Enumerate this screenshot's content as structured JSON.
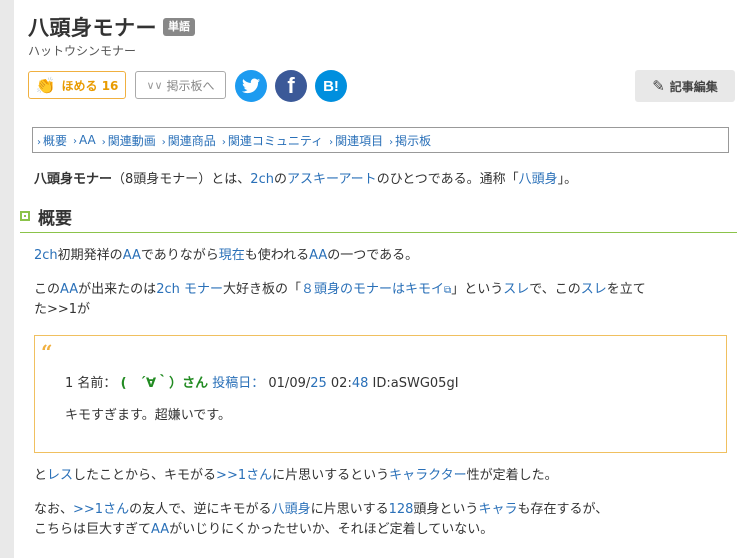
{
  "article": {
    "title": "八頭身モナー",
    "tag": "単語",
    "reading": "ハットウシンモナー"
  },
  "buttons": {
    "homeru": "ほめる 16",
    "keiji": "掲示板へ",
    "edit": "記事編集"
  },
  "toc": [
    "概要",
    "AA",
    "関連動画",
    "関連商品",
    "関連コミュニティ",
    "関連項目",
    "掲示板"
  ],
  "intro": {
    "bold": "八頭身モナー",
    "t1": "（8頭身モナー）とは、",
    "l1": "2ch",
    "t2": "の",
    "l2": "アスキーアート",
    "t3": "のひとつである。通称「",
    "l3": "八頭身",
    "t4": "」。"
  },
  "section": {
    "heading": "概要"
  },
  "para1": {
    "l1": "2ch",
    "t1": "初期発祥の",
    "l2": "AA",
    "t2": "でありながら",
    "l3": "現在",
    "t3": "も使われる",
    "l4": "AA",
    "t4": "の一つである。"
  },
  "para2": {
    "t1": "この",
    "l1": "AA",
    "t2": "が出来たのは",
    "l2": "2ch",
    "t3": " ",
    "l3": "モナー",
    "t4": "大好き板の「",
    "l4": "８頭身のモナーはキモイ",
    "t5": "」という",
    "l5": "スレ",
    "t6": "で、この",
    "l6": "スレ",
    "t7": "を立て",
    "line2": "た>>1が"
  },
  "quote": {
    "num": "1",
    "name_label": "名前：",
    "name": "(　´∀｀）さん",
    "posted_label": "投稿日：",
    "date": "01/09/",
    "date_link": "25",
    "time": " 02:",
    "time_link": "48",
    "id": "ID:aSWG05gI",
    "body": "キモすぎます。超嫌いです。"
  },
  "para3": {
    "t1": "と",
    "l1": "レス",
    "t2": "したことから、キモがる",
    "l2": ">>1さん",
    "t3": "に片思いするという",
    "l3": "キャラクター",
    "t4": "性が定着した。"
  },
  "para4": {
    "t1": "なお、",
    "l1": ">>1さん",
    "t2": "の友人で、逆にキモがる",
    "l2": "八頭身",
    "t3": "に片思いする",
    "l3": "128",
    "t4": "頭身という",
    "l4": "キャラ",
    "t5": "も存在するが、",
    "line2a": "こちらは巨大すぎて",
    "line2l": "AA",
    "line2b": "がいじりにくかったせいか、それほど定着していない。"
  }
}
